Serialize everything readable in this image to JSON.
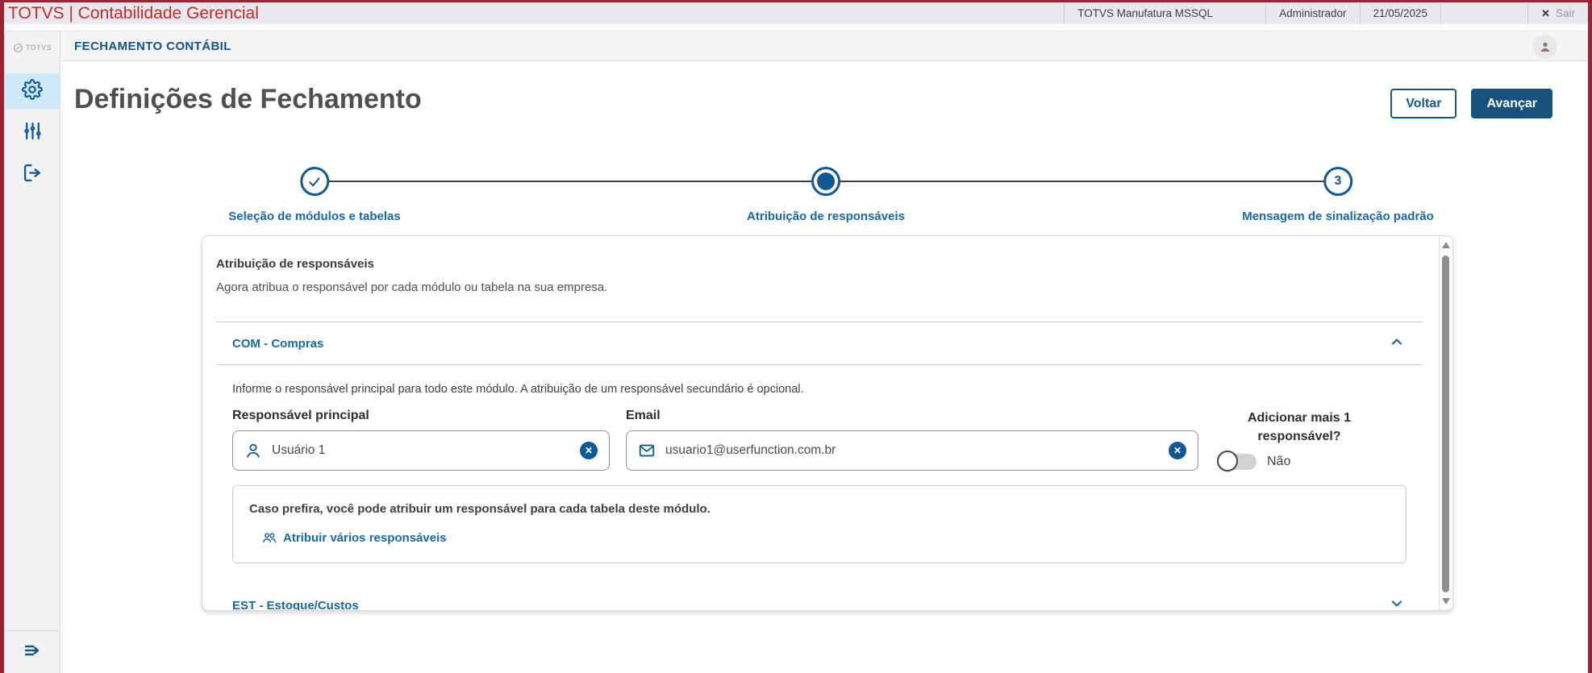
{
  "topbar": {
    "title": "TOTVS | Contabilidade Gerencial",
    "environment": "TOTVS Manufatura MSSQL",
    "user": "Administrador",
    "date": "21/05/2025",
    "close_icon": "✕",
    "logout_label": "Sair"
  },
  "sidebar": {
    "logo_text": "TOTVS"
  },
  "header": {
    "module_title": "FECHAMENTO CONTÁBIL"
  },
  "page": {
    "title": "Definições de Fechamento",
    "back_button": "Voltar",
    "next_button": "Avançar"
  },
  "stepper": {
    "steps": [
      {
        "label": "Seleção de módulos e tabelas",
        "state": "done"
      },
      {
        "label": "Atribuição de responsáveis",
        "state": "active"
      },
      {
        "label": "Mensagem de sinalização padrão",
        "state": "todo",
        "number": "3"
      }
    ]
  },
  "card": {
    "heading": "Atribuição de responsáveis",
    "description": "Agora atribua o responsável por cada módulo ou tabela na sua empresa.",
    "module": {
      "title": "COM - Compras",
      "instruction": "Informe o responsável principal para todo este módulo. A atribuição de um responsável secundário é opcional.",
      "responsible": {
        "label": "Responsável principal",
        "value": "Usuário 1"
      },
      "email": {
        "label": "Email",
        "value": "usuario1@userfunction.com.br"
      },
      "add_more": {
        "label": "Adicionar mais 1 responsável?",
        "value": "Não",
        "state": "off"
      },
      "subcard": {
        "text": "Caso prefira, você pode atribuir um responsável para cada tabela deste módulo.",
        "link": "Atribuir vários responsáveis"
      }
    },
    "next_module": {
      "title": "EST - Estoque/Custos"
    }
  },
  "colors": {
    "primary_blue": "#16527c",
    "link_blue": "#1569a9",
    "brand_red": "#c32b2b",
    "frame_red": "#9b2434",
    "active_item_bg": "#cfe9f8"
  }
}
